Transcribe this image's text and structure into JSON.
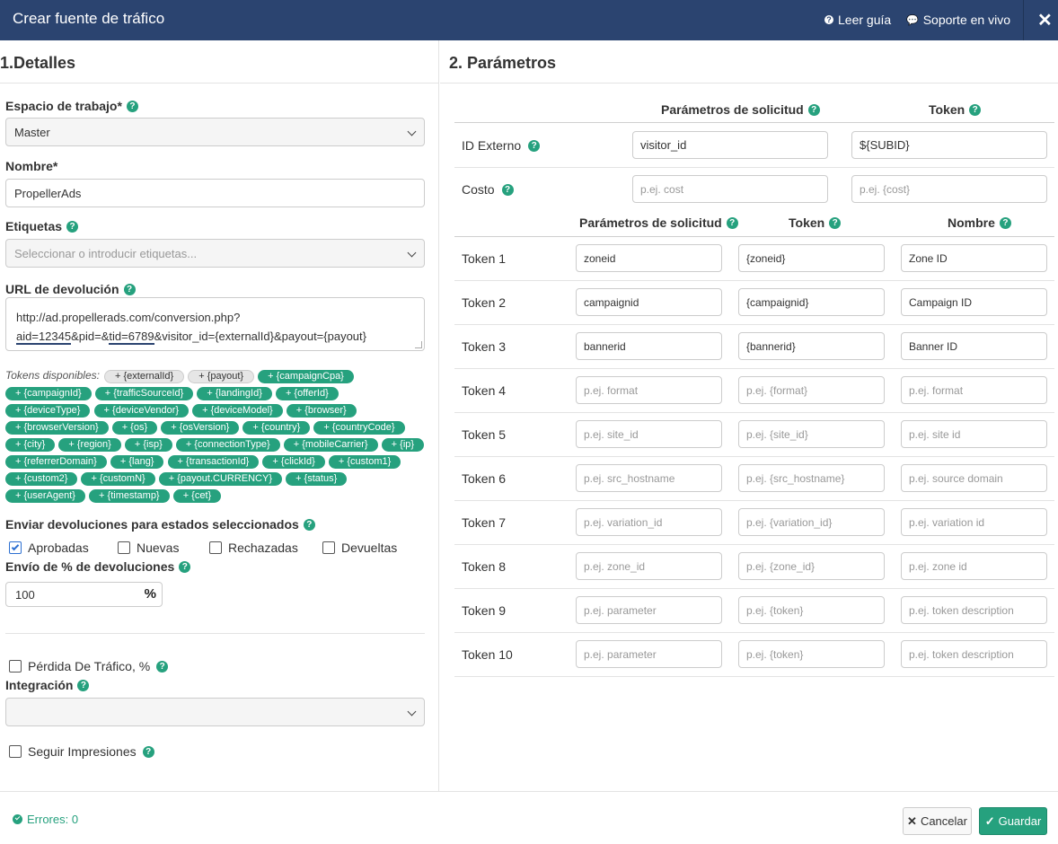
{
  "header": {
    "title": "Crear fuente de tráfico",
    "guide_label": "Leer guía",
    "support_label": "Soporte en vivo",
    "close_label": "✕"
  },
  "details": {
    "title": "1.Detalles",
    "workspace_label": "Espacio de trabajo*",
    "workspace_value": "Master",
    "name_label": "Nombre*",
    "name_value": "PropellerAds",
    "tags_label": "Etiquetas",
    "tags_placeholder": "Seleccionar o introducir etiquetas...",
    "postback_label": "URL de devolución",
    "postback_line1": "http://ad.propellerads.com/conversion.php?",
    "postback_p1": "aid=12345",
    "postback_p2": "&pid=&",
    "postback_p3": "tid=6789",
    "postback_p4": "&visitor_id={externalId}&payout={payout}",
    "tokens_label": "Tokens disponibles:",
    "tokens": [
      "+ {externalId}",
      "+ {payout}",
      "+ {campaignCpa}",
      "+ {campaignId}",
      "+ {trafficSourceId}",
      "+ {landingId}",
      "+ {offerId}",
      "+ {deviceType}",
      "+ {deviceVendor}",
      "+ {deviceModel}",
      "+ {browser}",
      "+ {browserVersion}",
      "+ {os}",
      "+ {osVersion}",
      "+ {country}",
      "+ {countryCode}",
      "+ {city}",
      "+ {region}",
      "+ {isp}",
      "+ {connectionType}",
      "+ {mobileCarrier}",
      "+ {ip}",
      "+ {referrerDomain}",
      "+ {lang}",
      "+ {transactionId}",
      "+ {clickId}",
      "+ {custom1}",
      "+ {custom2}",
      "+ {customN}",
      "+ {payout.CURRENCY}",
      "+ {status}",
      "+ {userAgent}",
      "+ {timestamp}",
      "+ {cet}"
    ],
    "send_label": "Enviar devoluciones para estados seleccionados",
    "statuses": [
      {
        "label": "Aprobadas",
        "checked": true
      },
      {
        "label": "Nuevas",
        "checked": false
      },
      {
        "label": "Rechazadas",
        "checked": false
      },
      {
        "label": "Devueltas",
        "checked": false
      }
    ],
    "percent_label": "Envío de % de devoluciones",
    "percent_value": "100",
    "percent_symbol": "%",
    "traffic_loss_label": "Pérdida De Tráfico, %",
    "integration_label": "Integración",
    "integration_value": "",
    "impressions_label": "Seguir Impresiones"
  },
  "params": {
    "title": "2. Parámetros",
    "head_param": "Parámetros de solicitud",
    "head_token": "Token",
    "head_name": "Nombre",
    "external_label": "ID Externo",
    "external_param": "visitor_id",
    "external_token": "${SUBID}",
    "cost_label": "Costo",
    "cost_param_ph": "p.ej. cost",
    "cost_token_ph": "p.ej. {cost}",
    "rows": [
      {
        "label": "Token 1",
        "param": "zoneid",
        "token": "{zoneid}",
        "name": "Zone ID",
        "ph": false
      },
      {
        "label": "Token 2",
        "param": "campaignid",
        "token": "{campaignid}",
        "name": "Campaign ID",
        "ph": false
      },
      {
        "label": "Token 3",
        "param": "bannerid",
        "token": "{bannerid}",
        "name": "Banner ID",
        "ph": false
      },
      {
        "label": "Token 4",
        "param": "p.ej. format",
        "token": "p.ej. {format}",
        "name": "p.ej. format",
        "ph": true
      },
      {
        "label": "Token 5",
        "param": "p.ej. site_id",
        "token": "p.ej. {site_id}",
        "name": "p.ej. site id",
        "ph": true
      },
      {
        "label": "Token 6",
        "param": "p.ej. src_hostname",
        "token": "p.ej.  {src_hostname}",
        "name": "p.ej. source domain",
        "ph": true
      },
      {
        "label": "Token 7",
        "param": "p.ej. variation_id",
        "token": "p.ej. {variation_id}",
        "name": "p.ej. variation id",
        "ph": true
      },
      {
        "label": "Token 8",
        "param": "p.ej. zone_id",
        "token": "p.ej. {zone_id}",
        "name": "p.ej. zone id",
        "ph": true
      },
      {
        "label": "Token 9",
        "param": "p.ej. parameter",
        "token": "p.ej. {token}",
        "name": "p.ej. token description",
        "ph": true
      },
      {
        "label": "Token 10",
        "param": "p.ej. parameter",
        "token": "p.ej. {token}",
        "name": "p.ej. token description",
        "ph": true
      }
    ]
  },
  "footer": {
    "errors_label": "Errores: 0",
    "cancel_label": "Cancelar",
    "save_label": "Guardar"
  }
}
